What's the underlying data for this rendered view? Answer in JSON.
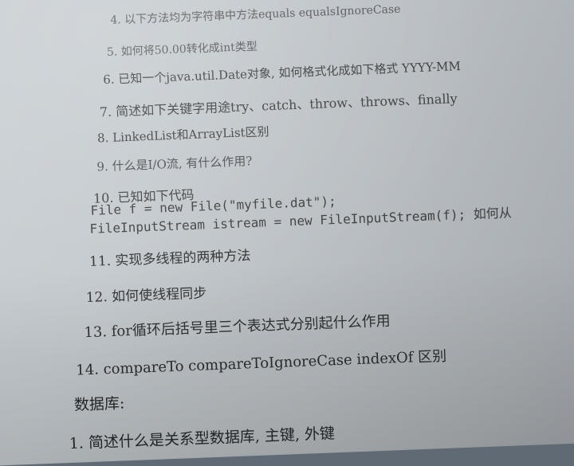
{
  "lines": {
    "q4": "4. 以下方法均为字符串中方法equals  equalsIgnoreCase",
    "q5": "5. 如何将50.00转化成int类型",
    "q6": "6. 已知一个java.util.Date对象, 如何格式化成如下格式 YYYY-MM",
    "q7": "7. 简述如下关键字用途try、catch、throw、throws、finally",
    "q8": "8. LinkedList和ArrayList区别",
    "q9": "9. 什么是I/O流, 有什么作用?",
    "q10": "10. 已知如下代码",
    "code1": "File f = new File(\"myfile.dat\");",
    "code2": "FileInputStream  istream = new FileInputStream(f); 如何从",
    "q11": "11. 实现多线程的两种方法",
    "q12": "12. 如何使线程同步",
    "q13": "13. for循环后括号里三个表达式分别起什么作用",
    "q14": "14. compareTo  compareToIgnoreCase  indexOf 区别",
    "db_heading": "数据库:",
    "db_q1": "1. 简述什么是关系型数据库, 主键, 外键"
  }
}
